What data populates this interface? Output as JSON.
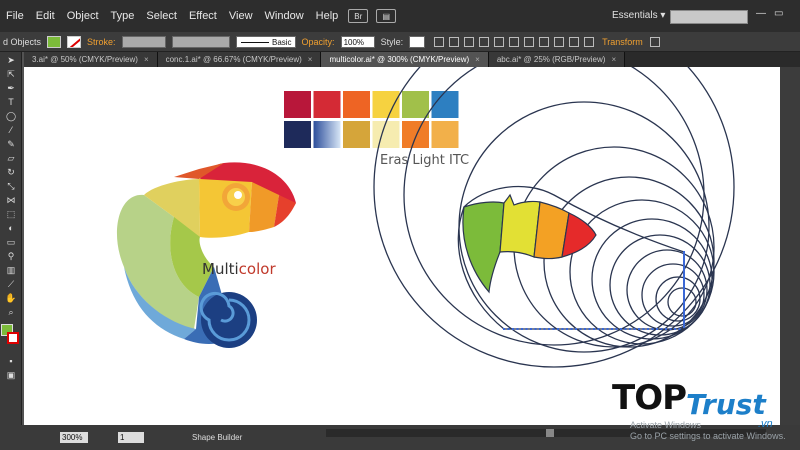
{
  "menubar": {
    "items": [
      "File",
      "Edit",
      "Object",
      "Type",
      "Select",
      "Effect",
      "View",
      "Window",
      "Help"
    ],
    "bridge_label": "Br",
    "workspace": "Essentials",
    "workspace_arrow": "▾"
  },
  "controlbar": {
    "selection_label": "d Objects",
    "stroke_label": "Stroke:",
    "stroke_style": "Basic",
    "opacity_label": "Opacity:",
    "opacity_value": "100%",
    "style_label": "Style:",
    "transform_label": "Transform",
    "colors": {
      "fill": "#7cbb3a",
      "stroke": "#ffffff",
      "accent": "#f0a030"
    }
  },
  "tabs": [
    {
      "label": "3.ai* @ 50% (CMYK/Preview)",
      "active": false
    },
    {
      "label": "conc.1.ai* @ 66.67% (CMYK/Preview)",
      "active": false
    },
    {
      "label": "multicolor.ai* @ 300% (CMYK/Preview)",
      "active": true
    },
    {
      "label": "abc.ai* @ 25% (RGB/Preview)",
      "active": false
    }
  ],
  "tab_close": "×",
  "tools": [
    "selection-tool",
    "direct-selection-tool",
    "pen-tool",
    "type-tool",
    "ellipse-tool",
    "brush-tool",
    "pencil-tool",
    "eraser-tool",
    "rotate-tool",
    "scale-tool",
    "width-tool",
    "free-transform-tool",
    "shape-builder-tool",
    "gradient-tool",
    "eyedropper-tool",
    "blend-tool",
    "symbol-tool",
    "graph-tool",
    "artboard-tool",
    "slice-tool",
    "hand-tool",
    "zoom-tool"
  ],
  "artwork": {
    "logo_text_dark": "Multi",
    "logo_text_colored": "color",
    "font_name": "Eras Light ITC",
    "palette_row1": [
      "#b8173a",
      "#d42a35",
      "#ee6424",
      "#f6d240",
      "#a1c04a",
      "#2d7fc1"
    ],
    "palette_row2": [
      "#1e2a5a",
      "#a8c4e6",
      "#d5a53a",
      "#f6ecb0",
      "#f07c28",
      "#f2b04a"
    ]
  },
  "statusbar": {
    "zoom": "300%",
    "page": "1",
    "current_tool": "Shape Builder"
  },
  "watermark": {
    "brand_top": "TOP",
    "brand_trust": "Trust",
    "brand_vn": ".vn",
    "activate_line1": "Activate Windows",
    "activate_line2": "Go to PC settings to activate Windows."
  }
}
